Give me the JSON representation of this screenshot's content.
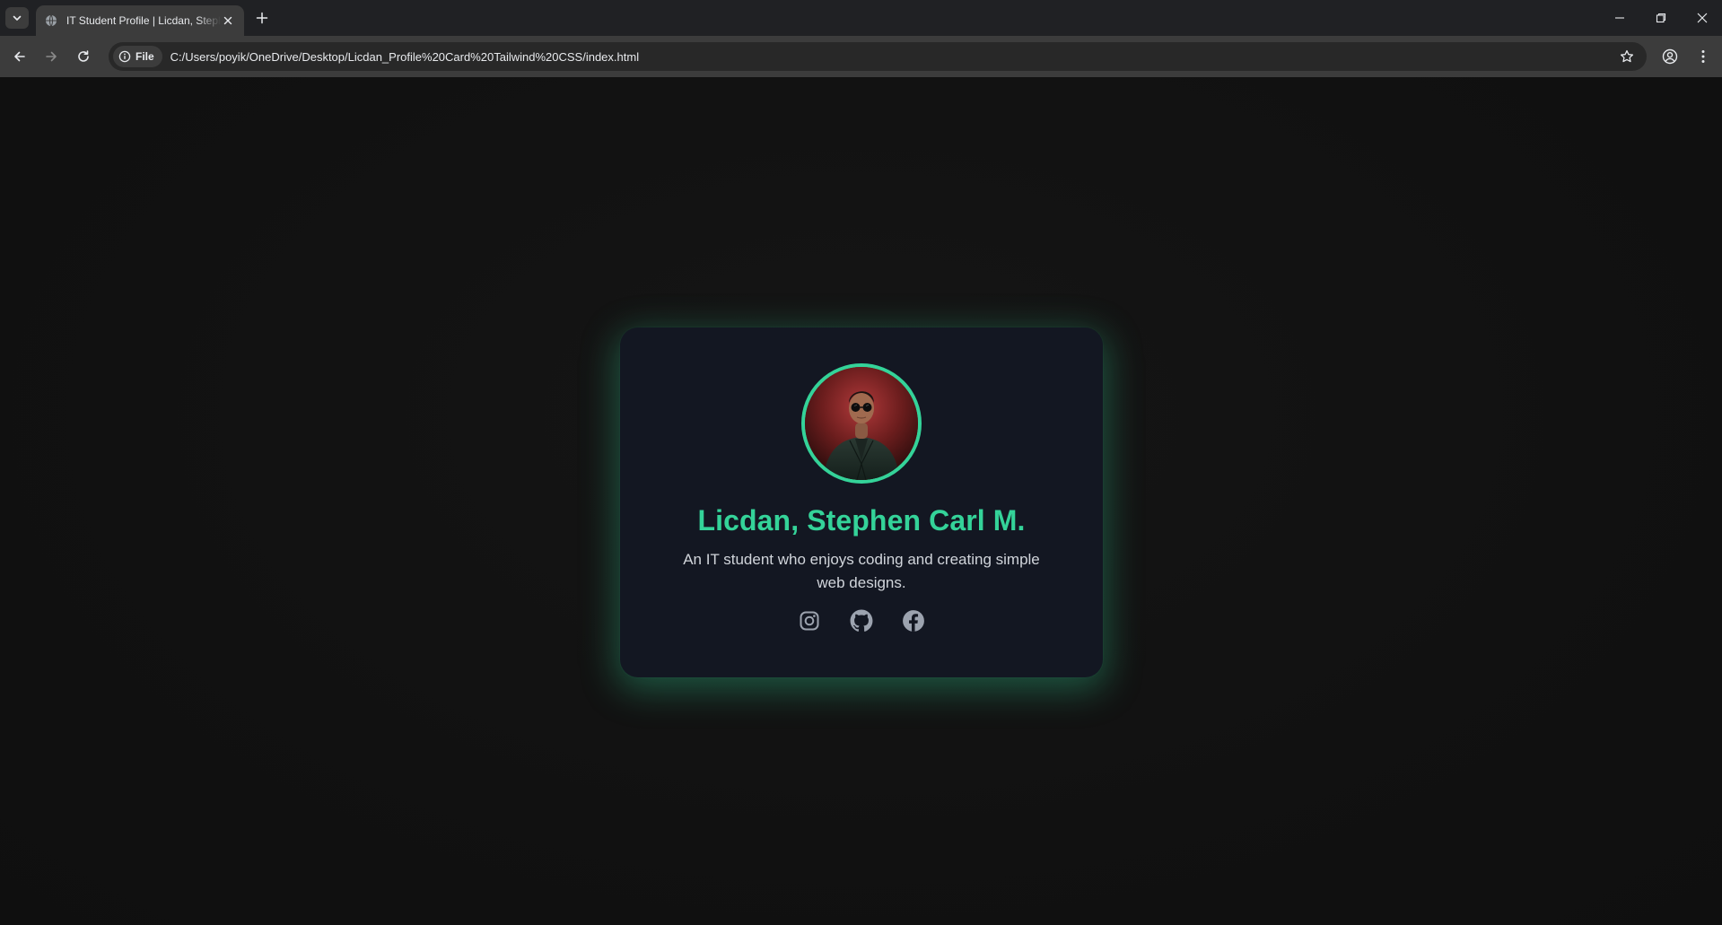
{
  "browser": {
    "tab_title": "IT Student Profile | Licdan, Stephen Carl M.",
    "security_chip_label": "File",
    "address_url": "C:/Users/poyik/OneDrive/Desktop/Licdan_Profile%20Card%20Tailwind%20CSS/index.html"
  },
  "profile": {
    "name": "Licdan, Stephen Carl M.",
    "bio": "An IT student who enjoys coding and creating simple web designs.",
    "avatar_icon": "profile-photo",
    "socials": [
      {
        "icon": "instagram-icon"
      },
      {
        "icon": "github-icon"
      },
      {
        "icon": "facebook-icon"
      }
    ]
  },
  "colors": {
    "accent": "#34d399",
    "card_bg": "#131722",
    "page_bg": "#111111",
    "bio_text": "#d1d5db",
    "icon": "#9ca3af"
  }
}
